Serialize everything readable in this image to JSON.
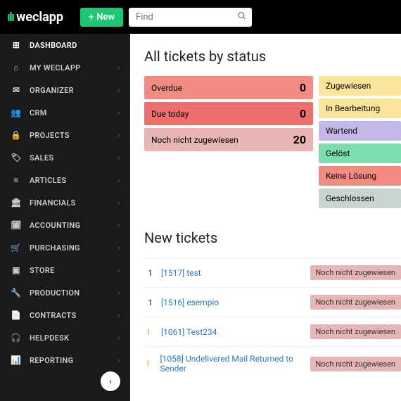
{
  "logo": "weclapp",
  "new_button": "New",
  "search_placeholder": "Find",
  "sidebar": [
    {
      "icon": "⊞",
      "label": "DASHBOARD",
      "active": true,
      "chev": false
    },
    {
      "icon": "⌂",
      "label": "MY WECLAPP",
      "chev": true
    },
    {
      "icon": "✉",
      "label": "ORGANIZER",
      "chev": true
    },
    {
      "icon": "👥",
      "label": "CRM",
      "chev": true
    },
    {
      "icon": "🔒",
      "label": "PROJECTS",
      "chev": true
    },
    {
      "icon": "🏷",
      "label": "SALES",
      "chev": true
    },
    {
      "icon": "≡",
      "label": "ARTICLES",
      "chev": true
    },
    {
      "icon": "🏛",
      "label": "FINANCIALS",
      "chev": true
    },
    {
      "icon": "🗓",
      "label": "ACCOUNTING",
      "chev": true
    },
    {
      "icon": "🛒",
      "label": "PURCHASING",
      "chev": true
    },
    {
      "icon": "▣",
      "label": "STORE",
      "chev": true
    },
    {
      "icon": "🔧",
      "label": "PRODUCTION",
      "chev": true
    },
    {
      "icon": "📄",
      "label": "CONTRACTS",
      "chev": true
    },
    {
      "icon": "🎧",
      "label": "HELPDESK",
      "chev": true
    },
    {
      "icon": "📊",
      "label": "REPORTING",
      "chev": true
    }
  ],
  "section1_title": "All tickets by status",
  "status_left": [
    {
      "label": "Overdue",
      "count": "0",
      "bg": "#f28b82"
    },
    {
      "label": "Due today",
      "count": "0",
      "bg": "#ef6e6e"
    },
    {
      "label": "Noch nicht zugewiesen",
      "count": "20",
      "bg": "#e8b5b5"
    }
  ],
  "status_right": [
    {
      "label": "Zugewiesen",
      "bg": "#f9e59a"
    },
    {
      "label": "In Bearbeitung",
      "bg": "#f9e59a"
    },
    {
      "label": "Wartend",
      "bg": "#c5b8e8"
    },
    {
      "label": "Gelöst",
      "bg": "#7eddb0"
    },
    {
      "label": "Keine Lösung",
      "bg": "#f28b82"
    },
    {
      "label": "Geschlossen",
      "bg": "#c8d4d0"
    }
  ],
  "section2_title": "New tickets",
  "tickets": [
    {
      "num": "1",
      "link": "[1517] test",
      "badge": "Noch nicht zugewiesen"
    },
    {
      "num": "1",
      "link": "[1516] esempio",
      "badge": "Noch nicht zugewiesen"
    },
    {
      "excl": true,
      "link": "[1061] Test234",
      "badge": "Noch nicht zugewiesen"
    },
    {
      "excl": true,
      "link": "[1058] Undelivered Mail Returned to Sender",
      "badge": "Noch nicht zugewiesen"
    }
  ]
}
